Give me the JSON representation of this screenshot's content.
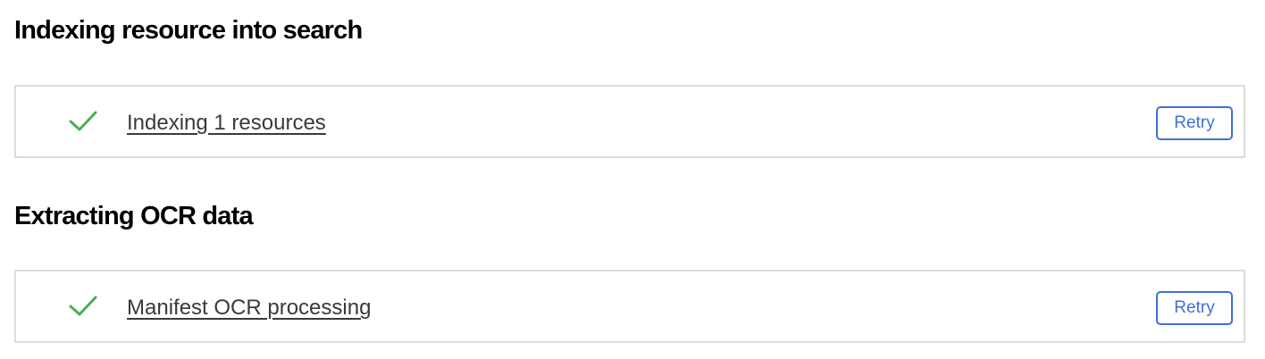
{
  "sections": [
    {
      "title": "Indexing resource into search",
      "task": {
        "status": "success",
        "status_icon": "check-icon",
        "label": "Indexing 1 resources",
        "retry_label": "Retry"
      }
    },
    {
      "title": "Extracting OCR data",
      "task": {
        "status": "success",
        "status_icon": "check-icon",
        "label": "Manifest OCR processing",
        "retry_label": "Retry"
      }
    }
  ],
  "colors": {
    "success": "#4caf50",
    "accent": "#3f6fd9",
    "border": "#dcdcdc"
  }
}
